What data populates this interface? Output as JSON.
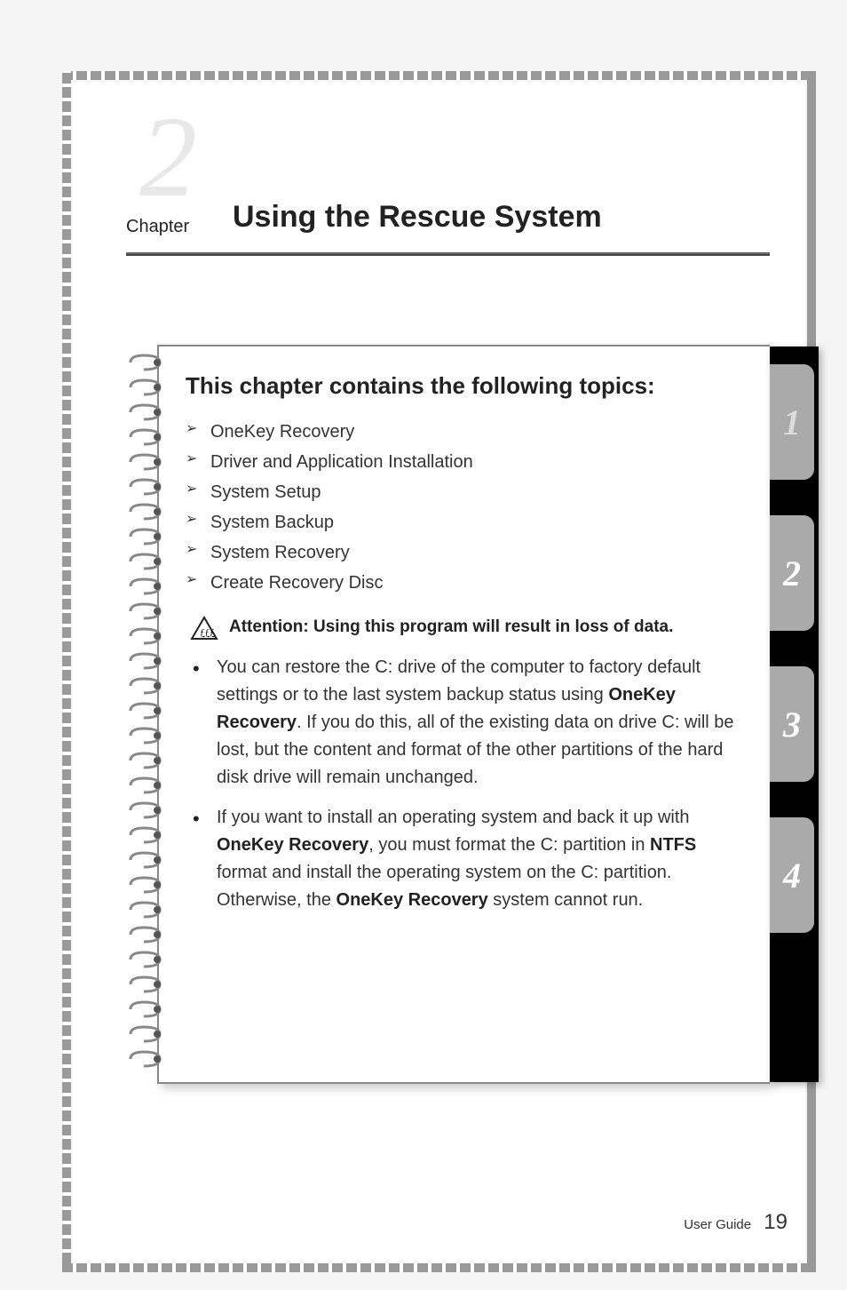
{
  "chapter": {
    "number": "2",
    "label": "Chapter",
    "title": "Using the Rescue System"
  },
  "topics": {
    "heading": "This chapter contains the following topics:",
    "items": [
      "OneKey Recovery",
      "Driver and Application Installation",
      "System Setup",
      "System Backup",
      "System Recovery",
      "Create Recovery Disc"
    ]
  },
  "attention": {
    "label": "Attention: Using this program will result in loss of data."
  },
  "bullets": [
    {
      "pre": "You can restore the C: drive of the computer to factory default settings or to the last system backup status using ",
      "bold1": "OneKey Recovery",
      "post": ". If you do this, all of the existing data on drive C: will be lost, but the content and format of the other partitions of the hard disk drive will remain unchanged."
    },
    {
      "pre": "If you want to install an operating system and back it up with ",
      "bold1": "OneKey Recovery",
      "mid1": ", you must format the C: partition in ",
      "bold2": "NTFS",
      "mid2": " format and install the operating system on the C: partition. Otherwise, the ",
      "bold3": "OneKey Recovery",
      "post": " system cannot run."
    }
  ],
  "tabs": [
    "1",
    "2",
    "3",
    "4"
  ],
  "footer": {
    "label": "User Guide",
    "page": "19"
  }
}
